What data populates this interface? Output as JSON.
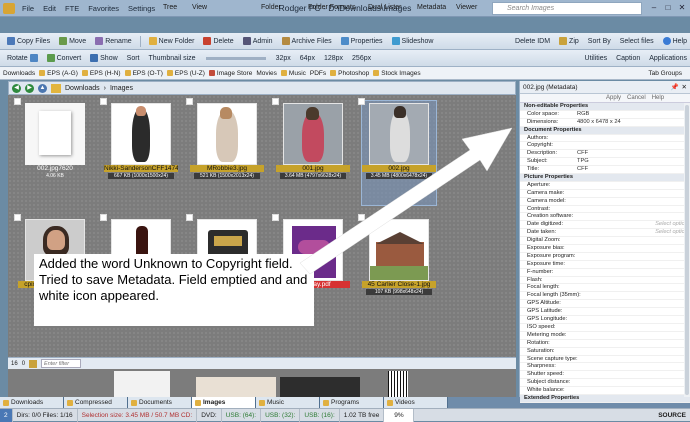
{
  "window": {
    "title": "Rodger PC - D:\\Downloads\\Images",
    "menu": [
      "File",
      "Edit",
      "FTE",
      "Favorites",
      "Settings"
    ],
    "title_controls": [
      "Tree",
      "View"
    ],
    "right_tools": [
      "Folder",
      "Folder Formats",
      "Dual Lister",
      "Metadata",
      "Viewer"
    ],
    "search_placeholder": "Search Images"
  },
  "toolbar1": {
    "items": [
      "Copy Files",
      "Move",
      "Rename",
      "New Folder",
      "Delete",
      "Admin",
      "Archive Files",
      "Properties",
      "Slideshow"
    ],
    "right": [
      "Delete IDM",
      "Zip",
      "Sort By",
      "Select files",
      "Help"
    ]
  },
  "toolbar2": {
    "items": [
      "Rotate",
      "Convert",
      "Show",
      "Sort",
      "Thumbnail size"
    ],
    "sizes": [
      "32px",
      "64px",
      "128px",
      "256px"
    ],
    "right": [
      "Utilities",
      "Caption",
      "Applications"
    ]
  },
  "bookmarks": {
    "items": [
      "Downloads",
      "EPS (A-G)",
      "EPS (H-N)",
      "EPS (O-T)",
      "EPS (U-Z)",
      "Image Store",
      "Movies",
      "Music",
      "PDFs",
      "Photoshop",
      "Stock Images"
    ],
    "tab_groups": "Tab Groups"
  },
  "address": {
    "path": [
      "Downloads",
      "Images"
    ]
  },
  "thumbnails": [
    {
      "name": "002.jpg7620",
      "meta": "4.06 KB"
    },
    {
      "name": "Nikki-SandersonCFF147405.jpg",
      "meta": "667 KB (1000x1500x24)"
    },
    {
      "name": "MRobbie3.jpg",
      "meta": "521 KB (1500x2013x24)"
    },
    {
      "name": "001.jpg",
      "meta": "3.64 MB (4797x6628x24)"
    },
    {
      "name": "002.jpg",
      "meta": "3.45 MB (4800x6478x24)"
    },
    {
      "name": "cpix",
      "meta": ""
    },
    {
      "name": "",
      "meta": ""
    },
    {
      "name": "",
      "meta": ""
    },
    {
      "name": "Silk Tray.pdf",
      "meta": ""
    },
    {
      "name": "45 Carlier Close-1.jpg",
      "meta": "107 KB (998x648x24)"
    }
  ],
  "annotation": "Added the word Unknown to Copyright field. Tried to save Metadata. Field emptied and  and white icon appeared.",
  "bottom_bar": {
    "count_a": "16",
    "count_b": "0",
    "filter_placeholder": "Enter filter"
  },
  "tabs": [
    "Downloads",
    "Compressed",
    "Documents",
    "Images",
    "Music",
    "Programs",
    "Videos"
  ],
  "active_tab": "Images",
  "status": {
    "num": "2",
    "dirs": "Dirs: 0/0  Files: 1/16",
    "selection": "Selection size: 3.45 MB / 50.7 MB  CD:",
    "dvd": "DVD:",
    "usb1": "USB: (64):",
    "usb2": "USB: (32):",
    "usb3": "USB: (16):",
    "tb": "1.02 TB free",
    "pct": "9%",
    "source": "SOURCE"
  },
  "metadata": {
    "header": "002.jpg (Metadata)",
    "actions": [
      "Apply",
      "Cancel",
      "Help"
    ],
    "sections": [
      {
        "title": "Non-editable Properties",
        "rows": [
          [
            "Color space:",
            "RGB"
          ],
          [
            "Dimensions:",
            "4800 x 6478 x 24"
          ]
        ]
      },
      {
        "title": "Document Properties",
        "rows": [
          [
            "Authors:",
            ""
          ],
          [
            "Copyright:",
            ""
          ],
          [
            "Description:",
            "CFF"
          ],
          [
            "Subject:",
            "TPG"
          ],
          [
            "Title:",
            "CFF"
          ]
        ]
      },
      {
        "title": "Picture Properties",
        "rows": [
          [
            "Aperture:",
            ""
          ],
          [
            "Camera make:",
            ""
          ],
          [
            "Camera model:",
            ""
          ],
          [
            "Contrast:",
            ""
          ],
          [
            "Creation software:",
            ""
          ],
          [
            "Date digitized:",
            "Select option"
          ],
          [
            "Date taken:",
            "Select option"
          ],
          [
            "Digital Zoom:",
            ""
          ],
          [
            "Exposure bias:",
            ""
          ],
          [
            "Exposure program:",
            ""
          ],
          [
            "Exposure time:",
            ""
          ],
          [
            "F-number:",
            ""
          ],
          [
            "Flash:",
            ""
          ],
          [
            "Focal length:",
            ""
          ],
          [
            "Focal length (35mm):",
            ""
          ],
          [
            "GPS Altitude:",
            ""
          ],
          [
            "GPS Latitude:",
            ""
          ],
          [
            "GPS Longitude:",
            ""
          ],
          [
            "ISO speed:",
            ""
          ],
          [
            "Metering mode:",
            ""
          ],
          [
            "Rotation:",
            ""
          ],
          [
            "Saturation:",
            ""
          ],
          [
            "Scene capture type:",
            ""
          ],
          [
            "Sharpness:",
            ""
          ],
          [
            "Shutter speed:",
            ""
          ],
          [
            "Subject distance:",
            ""
          ],
          [
            "White balance:",
            ""
          ]
        ]
      },
      {
        "title": "Extended Properties",
        "rows": []
      }
    ]
  }
}
